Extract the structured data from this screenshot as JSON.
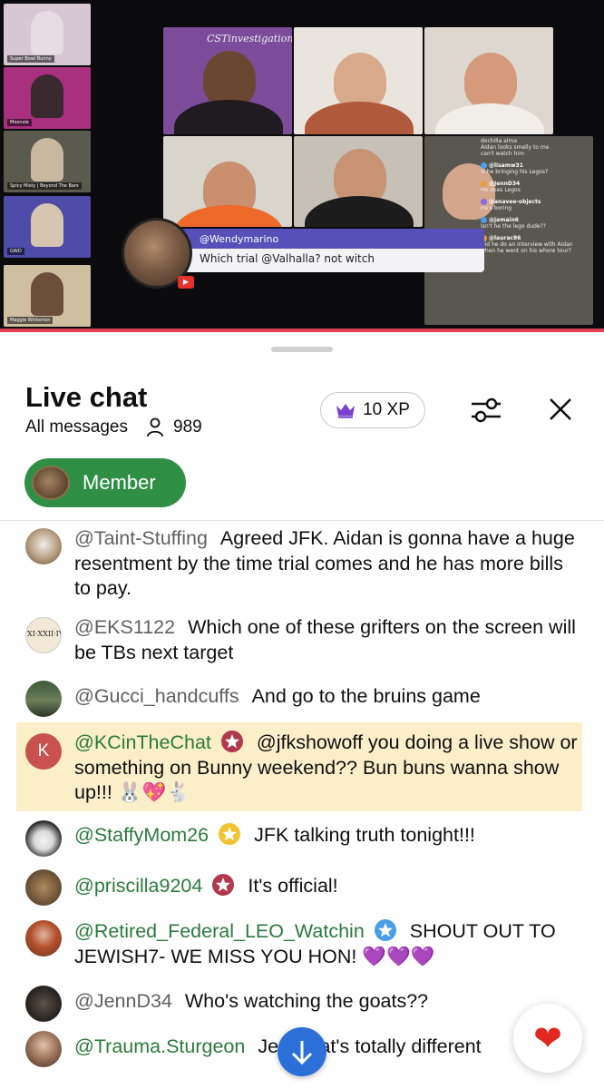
{
  "video": {
    "side_tiles": [
      {
        "name": "Super Bowl Bunny",
        "color": "#d9b8c6"
      },
      {
        "name": "Moonsie",
        "color": "#b33a8a"
      },
      {
        "name": "Spicy Misty | Beyond The Bars",
        "color": "#6b6a5c"
      },
      {
        "name": "GWD",
        "color": "#5a58b0"
      },
      {
        "name": "Maggie Winterton",
        "color": "#d8c9a8"
      }
    ],
    "show_logo": "CSTinvestigation",
    "overlay_author": "@Wendymarino",
    "overlay_message": "Which trial @Valhalla? not witch",
    "side_chat": [
      {
        "name": "",
        "text": "dochilla alma"
      },
      {
        "name": "",
        "text": "Aidan looks smelly to me"
      },
      {
        "name": "",
        "text": "can't watch him"
      },
      {
        "name": "@lisamw31",
        "text": "Is he bringing his Legos?"
      },
      {
        "name": "@JennD34",
        "text": "He does Legos"
      },
      {
        "name": "@anavee-objects",
        "text": "He's boring"
      },
      {
        "name": "@jamain6",
        "text": "Isn't he the lego dude??"
      },
      {
        "name": "@laurac86",
        "text": "Did he do an interview with Aidan when he went on his whore tour?"
      }
    ]
  },
  "chat": {
    "title": "Live chat",
    "filter_label": "All messages",
    "viewer_count": "989",
    "xp_label": "10 XP",
    "member_chip_label": "Member"
  },
  "messages": [
    {
      "author": "@Taint-Stuffing",
      "text": "Agreed JFK. Aidan is gonna have a huge resentment by the time trial comes and he has more bills to pay."
    },
    {
      "author": "@EKS1122",
      "text": "Which one of these grifters on the screen will be TBs next target"
    },
    {
      "author": "@Gucci_handcuffs",
      "text": "And go to the bruins game"
    },
    {
      "author": "@KCinTheChat",
      "avatar_letter": "K",
      "text": "@jfkshowoff you doing a live show or something on Bunny weekend?? Bun buns wanna show up!!! 🐰💖🐇"
    },
    {
      "author": "@StaffyMom26",
      "text": "JFK talking truth tonight!!!"
    },
    {
      "author": "@priscilla9204",
      "text": "It's official!"
    },
    {
      "author": "@Retired_Federal_LEO_Watchin",
      "text": "SHOUT OUT TO JEWISH7- WE MISS YOU HON!",
      "hearts": "💜💜💜"
    },
    {
      "author": "@JennD34",
      "text": "Who's watching the goats??"
    },
    {
      "author": "@Trauma.Sturgeon",
      "text": "Jess that's totally different"
    }
  ],
  "colors": {
    "member_green": "#2f8f45",
    "author_green": "#2b7a3b",
    "highlight": "#fbefc9",
    "scroll_button": "#2d6fd9",
    "moderator_badge": "#b0394b",
    "gold_badge": "#f2c230",
    "verified_badge": "#4a9ee8"
  },
  "icons": {
    "xp": "crown-icon",
    "filter": "sliders-icon",
    "close": "close-icon",
    "viewers": "person-icon",
    "scroll": "arrow-down-icon",
    "reaction": "heart-icon"
  }
}
